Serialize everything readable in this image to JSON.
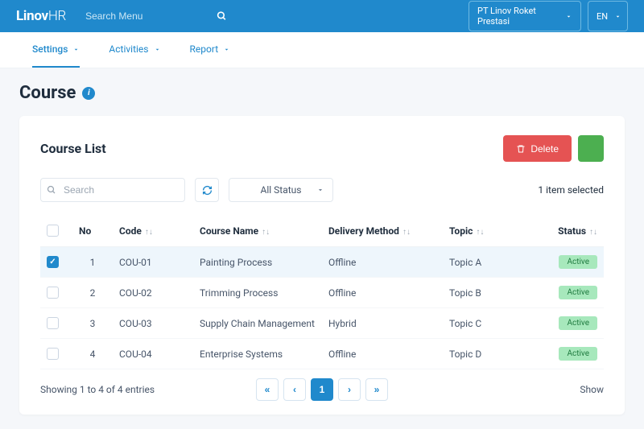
{
  "header": {
    "logo_main": "Linov",
    "logo_sub": "HR",
    "search_placeholder": "Search Menu",
    "company": "PT Linov Roket Prestasi",
    "lang": "EN"
  },
  "tabs": [
    {
      "label": "Settings",
      "active": true
    },
    {
      "label": "Activities",
      "active": false
    },
    {
      "label": "Report",
      "active": false
    }
  ],
  "page": {
    "title": "Course"
  },
  "card": {
    "title": "Course List",
    "delete_label": "Delete",
    "search_placeholder": "Search",
    "status_filter": "All Status",
    "item_count": "1 item selected"
  },
  "columns": {
    "no": "No",
    "code": "Code",
    "name": "Course Name",
    "delivery": "Delivery Method",
    "topic": "Topic",
    "status": "Status"
  },
  "rows": [
    {
      "no": "1",
      "code": "COU-01",
      "name": "Painting Process",
      "delivery": "Offline",
      "topic": "Topic A",
      "status": "Active",
      "checked": true
    },
    {
      "no": "2",
      "code": "COU-02",
      "name": "Trimming Process",
      "delivery": "Offline",
      "topic": "Topic B",
      "status": "Active",
      "checked": false
    },
    {
      "no": "3",
      "code": "COU-03",
      "name": "Supply Chain Management",
      "delivery": "Hybrid",
      "topic": "Topic C",
      "status": "Active",
      "checked": false
    },
    {
      "no": "4",
      "code": "COU-04",
      "name": "Enterprise Systems",
      "delivery": "Offline",
      "topic": "Topic D",
      "status": "Active",
      "checked": false
    }
  ],
  "footer": {
    "showing": "Showing 1 to 4 of 4 entries",
    "page": "1",
    "rows_label": "Show"
  }
}
